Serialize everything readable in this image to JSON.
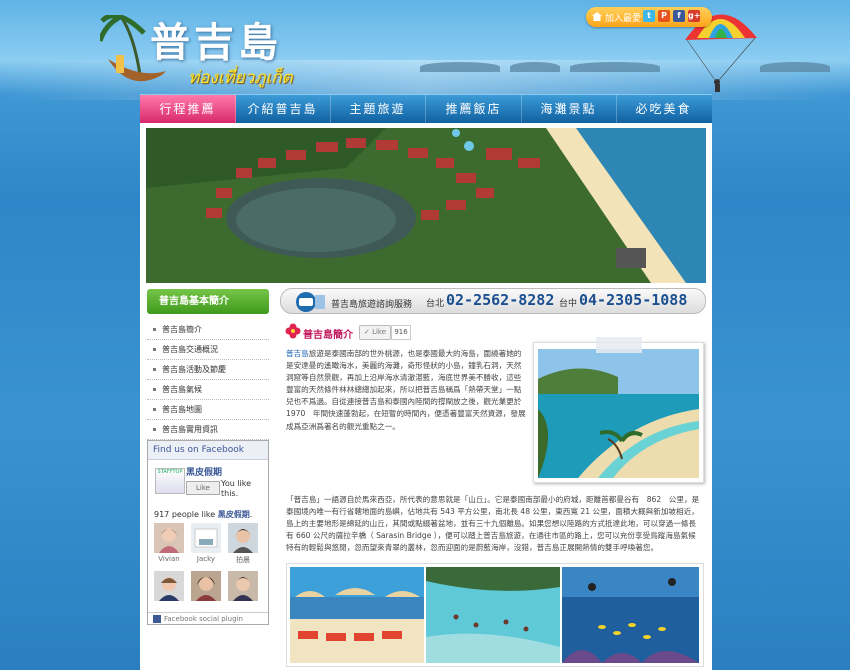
{
  "header": {
    "title": "普吉島",
    "subtitle_thai": "ท่องเที่ยวภูเก็ต"
  },
  "social": {
    "home_label": "加入最愛",
    "icons": [
      "twitter-icon",
      "plurk-icon",
      "facebook-icon",
      "google-plus-icon"
    ],
    "icon_glyphs": [
      "t",
      "P",
      "f",
      "g+"
    ]
  },
  "nav": {
    "items": [
      "行程推薦",
      "介紹普吉島",
      "主題旅遊",
      "推薦飯店",
      "海灘景點",
      "必吃美食"
    ],
    "active_index": 0
  },
  "sidebar": {
    "heading": "普吉島基本簡介",
    "menu": [
      "普吉島簡介",
      "普吉島交通概況",
      "普吉島活動及節慶",
      "普吉島氣候",
      "普吉島地圖",
      "普吉島實用資訊"
    ]
  },
  "facebook": {
    "heading": "Find us on Facebook",
    "page_name": "黑皮假期",
    "page_thumb_text": "STAFFTOP",
    "like_label": "Like",
    "you_like": "You like this.",
    "count_prefix": "917 people like ",
    "count_page": "黑皮假期",
    "count_suffix": ".",
    "friends": [
      "Vivian",
      "Jacky",
      "拍晨",
      "",
      "",
      ""
    ],
    "footer": "Facebook social plugin"
  },
  "contact": {
    "service_label": "普吉島旅遊諮詢服務",
    "taipei_label": "台北",
    "taipei_phone": "02-2562-8282",
    "taichung_label": "台中",
    "taichung_phone": "04-2305-1088"
  },
  "article": {
    "title": "普吉島簡介",
    "like_label": "Like",
    "like_count": "916",
    "para1_link": "普吉島",
    "para1": "旅遊是泰國南部的世外桃源，也是泰國最大的海島，圍繞著她的是安達曼的遙瞰海水，美麗的海灘，奇形怪狀的小島，鐘乳石洞，天然洞窟等自然景觀，再加上沿岸海水清澈湛藍，海底世界美不勝收，這些豐富的天然條件林林總總加起來，所以把普吉島稱爲「熱帶天堂」一點兒也不爲過。自從連接普吉島和泰國內陸間的撐閘放之後，觀光業更於1970　年間快速蓬勃起，在短暫的時間內，便憑著豐富天然資源，發展成爲亞洲爲著名的觀光重點之一。",
    "para2": "「普吉島」一語源自於馬來西亞，所代表的意思就是「山丘」。它是泰國南部最小的府城，距離首都曼谷有　862　公里，是泰國境內唯一有行省轄地面的島嶼，佔地共有 543 平方公里，南北長 48 公里，東西寬 21 公里，面積大概與新加坡相近，島上的主要地形是綿延的山丘，其間或點綴著盆地，並有三十九個離島。如果您想以陸路的方式抵達此地，可以穿過一條長有 660 公尺的薩拉辛橋（ Sarasin Bridge ），便可以踏上普吉島旅遊，在通往市區的路上，您可以充份享受鳥蹤海島氣候特有的輕鬆與悠閒，忽而望來青翠的叢林，忽而迎面的是蔚藍海岸，沒錯，普吉島正展開熱情的雙手呼喚著您。"
  },
  "colors": {
    "nav_active": "#d6266a",
    "nav_bg": "#0f5f9e",
    "sidebar_head": "#4ea82a",
    "phone_color": "#1b4f8f",
    "title_pink": "#c2185b"
  }
}
